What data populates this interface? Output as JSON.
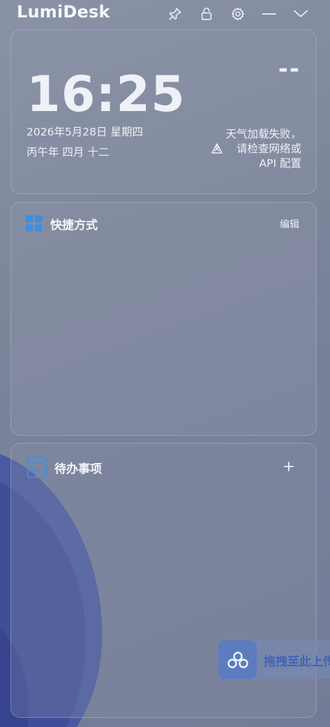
{
  "app": {
    "title": "LumiDesk"
  },
  "titlebar": {
    "icons": [
      "pin-icon",
      "lock-icon",
      "gear-icon",
      "minimize-icon",
      "chevron-down-icon"
    ]
  },
  "clock": {
    "time": "16:25",
    "date": "2026年5月28日 星期四",
    "lunar": "丙午年 四月 十二"
  },
  "weather": {
    "temperature": "--",
    "message": "天气加载失败，请检查网络或 API 配置",
    "icon": "weather-warning-icon"
  },
  "shortcuts": {
    "title": "快捷方式",
    "edit_label": "编辑",
    "icon": "grid-icon"
  },
  "todo": {
    "title": "待办事项",
    "add_label": "+",
    "icon": "checklist-icon"
  },
  "drag_toast": {
    "label": "拖拽至此上传",
    "icon": "cloud-upload-icon"
  },
  "colors": {
    "accent": "#3d8fe0",
    "toast_text": "#3f63b8"
  }
}
